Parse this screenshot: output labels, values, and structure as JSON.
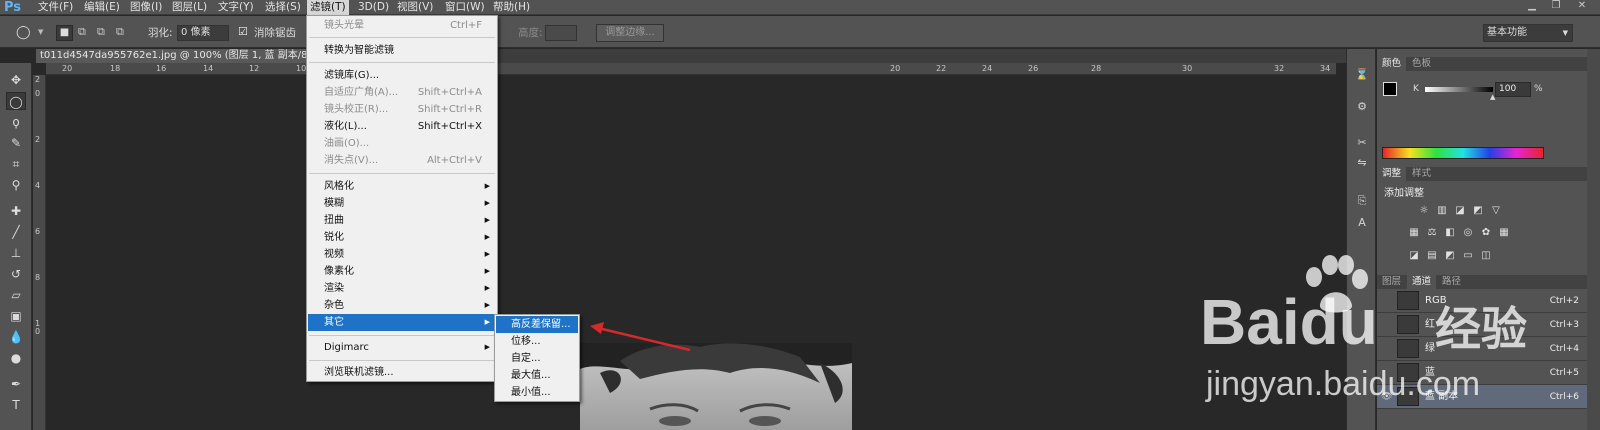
{
  "app": {
    "logo": "Ps"
  },
  "menubar": {
    "items": [
      "文件(F)",
      "编辑(E)",
      "图像(I)",
      "图层(L)",
      "文字(Y)",
      "选择(S)",
      "滤镜(T)",
      "3D(D)",
      "视图(V)",
      "窗口(W)",
      "帮助(H)"
    ],
    "active_index": 6
  },
  "options": {
    "feather_label": "羽化:",
    "feather_value": "0 像素",
    "antialias_label": "消除锯齿",
    "height_label": "高度:",
    "refine_edge": "调整边缘...",
    "workspace": "基本功能"
  },
  "document": {
    "tab_title": "t011d4547da955762e1.jpg @ 100% (图层 1, 蓝 副本/8) *"
  },
  "rulers": {
    "h_ticks": [
      "20",
      "18",
      "16",
      "14",
      "12",
      "10",
      "20",
      "22",
      "24",
      "26",
      "28",
      "30",
      "32",
      "34"
    ],
    "v_ticks": [
      "2",
      "0",
      "2",
      "4",
      "6",
      "8",
      "1",
      "0"
    ]
  },
  "filter_menu": {
    "items": [
      {
        "label": "镜头光晕",
        "shortcut": "Ctrl+F",
        "disabled": true
      },
      {
        "sep": true
      },
      {
        "label": "转换为智能滤镜"
      },
      {
        "sep": true
      },
      {
        "label": "滤镜库(G)..."
      },
      {
        "label": "自适应广角(A)...",
        "shortcut": "Shift+Ctrl+A",
        "disabled": true
      },
      {
        "label": "镜头校正(R)...",
        "shortcut": "Shift+Ctrl+R",
        "disabled": true
      },
      {
        "label": "液化(L)...",
        "shortcut": "Shift+Ctrl+X"
      },
      {
        "label": "油画(O)...",
        "disabled": true
      },
      {
        "label": "消失点(V)...",
        "shortcut": "Alt+Ctrl+V",
        "disabled": true
      },
      {
        "sep": true
      },
      {
        "label": "风格化",
        "submenu": true
      },
      {
        "label": "模糊",
        "submenu": true
      },
      {
        "label": "扭曲",
        "submenu": true
      },
      {
        "label": "锐化",
        "submenu": true
      },
      {
        "label": "视频",
        "submenu": true
      },
      {
        "label": "像素化",
        "submenu": true
      },
      {
        "label": "渲染",
        "submenu": true
      },
      {
        "label": "杂色",
        "submenu": true
      },
      {
        "label": "其它",
        "submenu": true,
        "highlighted": true
      },
      {
        "sep": true
      },
      {
        "label": "Digimarc",
        "submenu": true
      },
      {
        "sep": true
      },
      {
        "label": "浏览联机滤镜..."
      }
    ]
  },
  "other_submenu": {
    "items": [
      "高反差保留...",
      "位移...",
      "自定...",
      "最大值...",
      "最小值..."
    ],
    "highlighted_index": 0
  },
  "color_panel": {
    "tabs": [
      "颜色",
      "色板"
    ],
    "k_label": "K",
    "k_value": "100",
    "percent": "%"
  },
  "adjust_panel": {
    "tabs": [
      "调整",
      "样式"
    ],
    "heading": "添加调整"
  },
  "channels_panel": {
    "tabs": [
      "图层",
      "通道",
      "路径"
    ],
    "active_tab": 1,
    "rows": [
      {
        "name": "RGB",
        "shortcut": "Ctrl+2"
      },
      {
        "name": "红",
        "shortcut": "Ctrl+3"
      },
      {
        "name": "绿",
        "shortcut": "Ctrl+4"
      },
      {
        "name": "蓝",
        "shortcut": "Ctrl+5"
      },
      {
        "name": "蓝 副本",
        "shortcut": "Ctrl+6",
        "selected": true
      }
    ]
  },
  "watermark": {
    "brand": "Baidu",
    "brand_cn": "经验",
    "url": "jingyan.baidu.com"
  },
  "colors": {
    "menu_highlight": "#1e73c8",
    "ui_gray": "#535353",
    "canvas": "#282828",
    "arrow": "#d42a2a",
    "logo": "#5eb4f7"
  }
}
